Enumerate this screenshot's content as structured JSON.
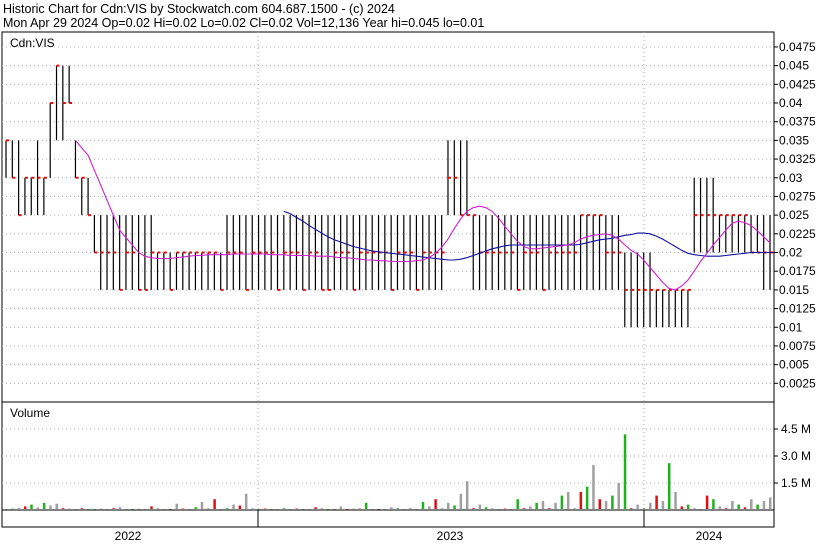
{
  "header": {
    "line1": "Historic Chart for Cdn:VIS by Stockwatch.com 604.687.1500 - (c) 2024",
    "line2": "Mon Apr 29 2024  Op=0.02  Hi=0.02  Lo=0.02  Cl=0.02  Vol=12,136  Year hi=0.045  lo=0.01"
  },
  "colors": {
    "price": "#000000",
    "close_tick": "#e01010",
    "ma_short": "#d020d0",
    "ma_long": "#1010a0",
    "vol_up": "#20b020",
    "vol_down": "#e01010",
    "vol_flat": "#a0a0a0",
    "grid": "#b0b0b0"
  },
  "chart_data": [
    {
      "type": "line",
      "panel": "price",
      "title": "Cdn:VIS",
      "ylim": [
        0,
        0.0495
      ],
      "yticks": [
        "0.0475",
        "0.045",
        "0.0425",
        "0.04",
        "0.0375",
        "0.035",
        "0.0325",
        "0.03",
        "0.0275",
        "0.025",
        "0.0225",
        "0.02",
        "0.0175",
        "0.015",
        "0.0125",
        "0.01",
        "0.0075",
        "0.005",
        "0.0025"
      ],
      "xticks": [
        "2022",
        "2023",
        "2024"
      ],
      "grid": true,
      "series": [
        {
          "style": "hlc-bars",
          "high": [
            0.035,
            0.035,
            0.035,
            0.03,
            0.03,
            0.035,
            0.03,
            0.04,
            0.045,
            0.045,
            0.045,
            0.035,
            0.03,
            0.03,
            0.025,
            0.025,
            0.025,
            0.025,
            0.025,
            0.025,
            0.025,
            0.025,
            0.025,
            0.025,
            0.02,
            0.02,
            0.02,
            0.02,
            0.02,
            0.02,
            0.02,
            0.02,
            0.02,
            0.02,
            0.02,
            0.025,
            0.025,
            0.025,
            0.025,
            0.025,
            0.025,
            0.025,
            0.025,
            0.025,
            0.025,
            0.025,
            0.025,
            0.025,
            0.025,
            0.025,
            0.025,
            0.025,
            0.025,
            0.025,
            0.025,
            0.025,
            0.025,
            0.025,
            0.025,
            0.025,
            0.025,
            0.025,
            0.025,
            0.025,
            0.025,
            0.025,
            0.025,
            0.025,
            0.025,
            0.025,
            0.035,
            0.035,
            0.035,
            0.035,
            0.025,
            0.025,
            0.025,
            0.025,
            0.025,
            0.025,
            0.025,
            0.025,
            0.025,
            0.025,
            0.025,
            0.025,
            0.025,
            0.025,
            0.025,
            0.025,
            0.025,
            0.025,
            0.025,
            0.025,
            0.025,
            0.025,
            0.025,
            0.025,
            0.02,
            0.02,
            0.02,
            0.02,
            0.02,
            0.015,
            0.015,
            0.015,
            0.015,
            0.015,
            0.015,
            0.03,
            0.03,
            0.03,
            0.03,
            0.025,
            0.025,
            0.025,
            0.025,
            0.025,
            0.025,
            0.025,
            0.025,
            0.025
          ],
          "low": [
            0.03,
            0.03,
            0.025,
            0.025,
            0.025,
            0.025,
            0.025,
            0.03,
            0.035,
            0.035,
            0.04,
            0.03,
            0.025,
            0.025,
            0.02,
            0.015,
            0.015,
            0.015,
            0.015,
            0.015,
            0.015,
            0.015,
            0.015,
            0.015,
            0.015,
            0.015,
            0.015,
            0.015,
            0.015,
            0.015,
            0.015,
            0.015,
            0.015,
            0.015,
            0.015,
            0.015,
            0.015,
            0.015,
            0.015,
            0.015,
            0.015,
            0.015,
            0.015,
            0.015,
            0.015,
            0.015,
            0.015,
            0.015,
            0.015,
            0.015,
            0.015,
            0.015,
            0.015,
            0.015,
            0.015,
            0.015,
            0.015,
            0.015,
            0.015,
            0.015,
            0.015,
            0.015,
            0.015,
            0.015,
            0.015,
            0.015,
            0.015,
            0.015,
            0.015,
            0.015,
            0.025,
            0.025,
            0.025,
            0.025,
            0.015,
            0.015,
            0.015,
            0.015,
            0.015,
            0.015,
            0.015,
            0.015,
            0.015,
            0.015,
            0.015,
            0.015,
            0.015,
            0.015,
            0.015,
            0.015,
            0.015,
            0.015,
            0.015,
            0.015,
            0.015,
            0.015,
            0.015,
            0.015,
            0.01,
            0.01,
            0.01,
            0.01,
            0.01,
            0.01,
            0.01,
            0.01,
            0.01,
            0.01,
            0.01,
            0.02,
            0.02,
            0.02,
            0.02,
            0.02,
            0.02,
            0.02,
            0.02,
            0.02,
            0.02,
            0.02,
            0.015,
            0.015
          ],
          "close": [
            0.035,
            0.03,
            0.025,
            0.03,
            0.03,
            0.03,
            0.03,
            0.04,
            0.045,
            0.04,
            0.04,
            0.03,
            0.03,
            0.025,
            0.02,
            0.02,
            0.02,
            0.02,
            0.015,
            0.02,
            0.02,
            0.015,
            0.015,
            0.02,
            0.02,
            0.02,
            0.015,
            0.02,
            0.02,
            0.02,
            0.02,
            0.02,
            0.02,
            0.02,
            0.015,
            0.02,
            0.02,
            0.02,
            0.015,
            0.02,
            0.02,
            0.02,
            0.02,
            0.015,
            0.02,
            0.02,
            0.02,
            0.015,
            0.02,
            0.02,
            0.015,
            0.015,
            0.02,
            0.02,
            0.02,
            0.015,
            0.02,
            0.02,
            0.02,
            0.02,
            0.02,
            0.015,
            0.02,
            0.02,
            0.02,
            0.015,
            0.02,
            0.02,
            0.02,
            0.02,
            0.03,
            0.03,
            0.025,
            0.025,
            0.025,
            0.02,
            0.02,
            0.02,
            0.02,
            0.02,
            0.02,
            0.015,
            0.02,
            0.02,
            0.02,
            0.015,
            0.02,
            0.02,
            0.02,
            0.02,
            0.02,
            0.025,
            0.025,
            0.025,
            0.025,
            0.02,
            0.02,
            0.02,
            0.015,
            0.015,
            0.015,
            0.015,
            0.015,
            0.015,
            0.015,
            0.015,
            0.015,
            0.015,
            0.015,
            0.025,
            0.025,
            0.025,
            0.025,
            0.025,
            0.025,
            0.025,
            0.025,
            0.025,
            0.02,
            0.02,
            0.02,
            0.02
          ]
        },
        {
          "style": "moving-average-short",
          "values": [
            null,
            null,
            null,
            null,
            null,
            null,
            null,
            null,
            null,
            null,
            null,
            0.035,
            0.034,
            0.033,
            0.031,
            0.029,
            0.027,
            0.025,
            0.023,
            0.022,
            0.021,
            0.02,
            0.0195,
            0.0193,
            0.0192,
            0.0192,
            0.0192,
            0.0193,
            0.0194,
            0.0195,
            0.0196,
            0.0196,
            0.0197,
            0.0197,
            0.0197,
            0.0197,
            0.0198,
            0.0198,
            0.0198,
            0.0198,
            0.0198,
            0.0198,
            0.0197,
            0.0197,
            0.0197,
            0.0196,
            0.0196,
            0.0196,
            0.0196,
            0.0195,
            0.0195,
            0.0195,
            0.0194,
            0.0193,
            0.0193,
            0.0192,
            0.0191,
            0.019,
            0.019,
            0.0189,
            0.0189,
            0.0188,
            0.0188,
            0.0188,
            0.0188,
            0.0189,
            0.019,
            0.0193,
            0.0199,
            0.0207,
            0.0218,
            0.0232,
            0.0245,
            0.0255,
            0.026,
            0.0262,
            0.026,
            0.0255,
            0.0246,
            0.0235,
            0.0225,
            0.0215,
            0.0208,
            0.0205,
            0.0205,
            0.0206,
            0.0207,
            0.0208,
            0.0209,
            0.021,
            0.0213,
            0.0218,
            0.0221,
            0.0223,
            0.0224,
            0.0225,
            0.0223,
            0.0218,
            0.021,
            0.0203,
            0.0198,
            0.019,
            0.018,
            0.017,
            0.016,
            0.0152,
            0.015,
            0.0155,
            0.0163,
            0.0175,
            0.0188,
            0.0199,
            0.021,
            0.022,
            0.023,
            0.0239,
            0.0242,
            0.024,
            0.0236,
            0.0229,
            0.0221,
            0.0213
          ]
        },
        {
          "style": "moving-average-long",
          "values": [
            null,
            null,
            null,
            null,
            null,
            null,
            null,
            null,
            null,
            null,
            null,
            null,
            null,
            null,
            null,
            null,
            null,
            null,
            null,
            null,
            null,
            null,
            null,
            null,
            null,
            null,
            null,
            null,
            null,
            null,
            null,
            null,
            null,
            null,
            null,
            null,
            null,
            null,
            null,
            null,
            null,
            null,
            null,
            null,
            0.0255,
            0.0252,
            0.0247,
            0.0242,
            0.0236,
            0.0231,
            0.0226,
            0.0221,
            0.0217,
            0.0214,
            0.0211,
            0.0208,
            0.0206,
            0.0204,
            0.0202,
            0.0201,
            0.02,
            0.0199,
            0.0198,
            0.0197,
            0.0196,
            0.0195,
            0.0194,
            0.0193,
            0.0192,
            0.0191,
            0.019,
            0.019,
            0.0191,
            0.0193,
            0.0196,
            0.0199,
            0.0202,
            0.0205,
            0.0207,
            0.0209,
            0.021,
            0.021,
            0.021,
            0.021,
            0.021,
            0.021,
            0.021,
            0.021,
            0.021,
            0.021,
            0.021,
            0.0211,
            0.0213,
            0.0215,
            0.0217,
            0.0218,
            0.0219,
            0.0221,
            0.0223,
            0.0224,
            0.0226,
            0.0226,
            0.0225,
            0.0222,
            0.0218,
            0.0213,
            0.0208,
            0.0203,
            0.0199,
            0.0197,
            0.0196,
            0.0195,
            0.0195,
            0.0195,
            0.0196,
            0.0197,
            0.0198,
            0.0199,
            0.02,
            0.02,
            0.02,
            0.02,
            0.02
          ]
        }
      ]
    },
    {
      "type": "bar",
      "panel": "volume",
      "title": "Volume",
      "ylim": [
        0,
        6.0
      ],
      "yticks": [
        "4.5 M",
        "3.0 M",
        "1.5 M"
      ],
      "values": [
        0.05,
        0.08,
        0.12,
        0.2,
        0.3,
        0.15,
        0.4,
        0.25,
        0.35,
        0.1,
        0.08,
        0.05,
        0.1,
        0.06,
        0.05,
        0.08,
        0.05,
        0.1,
        0.15,
        0.05,
        0.06,
        0.07,
        0.05,
        0.2,
        0.1,
        0.05,
        0.06,
        0.35,
        0.08,
        0.05,
        0.15,
        0.45,
        0.1,
        0.6,
        0.05,
        0.1,
        0.3,
        0.25,
        0.9,
        0.1,
        0.05,
        0.08,
        0.06,
        0.05,
        0.1,
        0.05,
        0.08,
        0.06,
        0.05,
        0.15,
        0.1,
        0.05,
        0.06,
        0.2,
        0.05,
        0.08,
        0.1,
        0.4,
        0.05,
        0.06,
        0.05,
        0.15,
        0.1,
        0.05,
        0.08,
        0.05,
        0.45,
        0.2,
        0.6,
        0.1,
        0.4,
        0.25,
        0.9,
        1.6,
        0.1,
        0.3,
        0.15,
        0.1,
        0.05,
        0.08,
        0.05,
        0.6,
        0.1,
        0.2,
        0.4,
        0.5,
        0.1,
        0.4,
        0.8,
        1.0,
        0.1,
        1.0,
        1.3,
        2.5,
        0.6,
        0.5,
        0.8,
        1.5,
        4.2,
        0.1,
        0.3,
        0.1,
        0.4,
        0.8,
        0.5,
        2.6,
        1.0,
        0.2,
        0.3,
        0.1,
        0.05,
        0.8,
        0.6,
        0.2,
        0.1,
        0.5,
        0.3,
        0.15,
        0.6,
        0.3,
        0.5,
        0.7
      ],
      "directions": [
        "f",
        "u",
        "f",
        "d",
        "u",
        "f",
        "u",
        "f",
        "f",
        "d",
        "f",
        "f",
        "d",
        "f",
        "u",
        "f",
        "f",
        "d",
        "f",
        "f",
        "u",
        "f",
        "f",
        "d",
        "f",
        "f",
        "u",
        "f",
        "d",
        "f",
        "u",
        "f",
        "f",
        "d",
        "f",
        "u",
        "f",
        "d",
        "f",
        "f",
        "u",
        "d",
        "f",
        "f",
        "u",
        "f",
        "d",
        "f",
        "f",
        "d",
        "f",
        "u",
        "f",
        "f",
        "d",
        "f",
        "f",
        "u",
        "f",
        "d",
        "f",
        "f",
        "u",
        "f",
        "d",
        "f",
        "u",
        "f",
        "d",
        "f",
        "f",
        "u",
        "f",
        "f",
        "d",
        "f",
        "u",
        "f",
        "f",
        "d",
        "f",
        "u",
        "d",
        "f",
        "u",
        "f",
        "d",
        "f",
        "u",
        "f",
        "f",
        "d",
        "u",
        "f",
        "d",
        "f",
        "u",
        "f",
        "u",
        "d",
        "f",
        "u",
        "f",
        "d",
        "f",
        "u",
        "f",
        "d",
        "u",
        "f",
        "f",
        "d",
        "u",
        "f",
        "d",
        "f",
        "u",
        "d",
        "f",
        "u"
      ]
    }
  ]
}
